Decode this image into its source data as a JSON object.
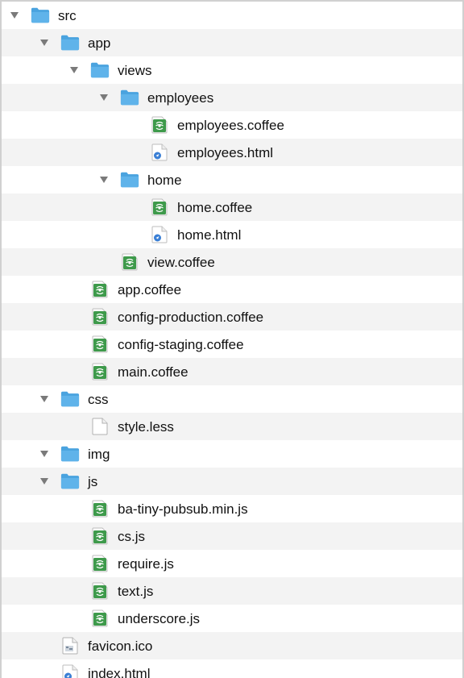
{
  "tree": [
    {
      "label": "src",
      "kind": "folder",
      "depth": 0,
      "expanded": true,
      "icon": "folder-icon"
    },
    {
      "label": "app",
      "kind": "folder",
      "depth": 1,
      "expanded": true,
      "icon": "folder-icon"
    },
    {
      "label": "views",
      "kind": "folder",
      "depth": 2,
      "expanded": true,
      "icon": "folder-icon"
    },
    {
      "label": "employees",
      "kind": "folder",
      "depth": 3,
      "expanded": true,
      "icon": "folder-icon"
    },
    {
      "label": "employees.coffee",
      "kind": "file",
      "depth": 4,
      "icon": "coffee-file-icon"
    },
    {
      "label": "employees.html",
      "kind": "file",
      "depth": 4,
      "icon": "html-file-icon"
    },
    {
      "label": "home",
      "kind": "folder",
      "depth": 3,
      "expanded": true,
      "icon": "folder-icon"
    },
    {
      "label": "home.coffee",
      "kind": "file",
      "depth": 4,
      "icon": "coffee-file-icon"
    },
    {
      "label": "home.html",
      "kind": "file",
      "depth": 4,
      "icon": "html-file-icon"
    },
    {
      "label": "view.coffee",
      "kind": "file",
      "depth": 3,
      "icon": "coffee-file-icon"
    },
    {
      "label": "app.coffee",
      "kind": "file",
      "depth": 2,
      "icon": "coffee-file-icon"
    },
    {
      "label": "config-production.coffee",
      "kind": "file",
      "depth": 2,
      "icon": "coffee-file-icon"
    },
    {
      "label": "config-staging.coffee",
      "kind": "file",
      "depth": 2,
      "icon": "coffee-file-icon"
    },
    {
      "label": "main.coffee",
      "kind": "file",
      "depth": 2,
      "icon": "coffee-file-icon"
    },
    {
      "label": "css",
      "kind": "folder",
      "depth": 1,
      "expanded": true,
      "icon": "folder-icon"
    },
    {
      "label": "style.less",
      "kind": "file",
      "depth": 2,
      "icon": "blank-file-icon"
    },
    {
      "label": "img",
      "kind": "folder",
      "depth": 1,
      "expanded": true,
      "icon": "folder-icon"
    },
    {
      "label": "js",
      "kind": "folder",
      "depth": 1,
      "expanded": true,
      "icon": "folder-icon"
    },
    {
      "label": "ba-tiny-pubsub.min.js",
      "kind": "file",
      "depth": 2,
      "icon": "coffee-file-icon"
    },
    {
      "label": "cs.js",
      "kind": "file",
      "depth": 2,
      "icon": "coffee-file-icon"
    },
    {
      "label": "require.js",
      "kind": "file",
      "depth": 2,
      "icon": "coffee-file-icon"
    },
    {
      "label": "text.js",
      "kind": "file",
      "depth": 2,
      "icon": "coffee-file-icon"
    },
    {
      "label": "underscore.js",
      "kind": "file",
      "depth": 2,
      "icon": "coffee-file-icon"
    },
    {
      "label": "favicon.ico",
      "kind": "file",
      "depth": 1,
      "icon": "ico-file-icon"
    },
    {
      "label": "index.html",
      "kind": "file",
      "depth": 1,
      "icon": "html-file-icon"
    }
  ],
  "colors": {
    "folder_blue": "#5fb3ea",
    "folder_blue_dark": "#4aa3df",
    "coffee_green": "#3e9a4b",
    "html_blue": "#3a7fd5",
    "disclosure_gray": "#7a7a7a",
    "row_alt": "#f3f3f3"
  }
}
